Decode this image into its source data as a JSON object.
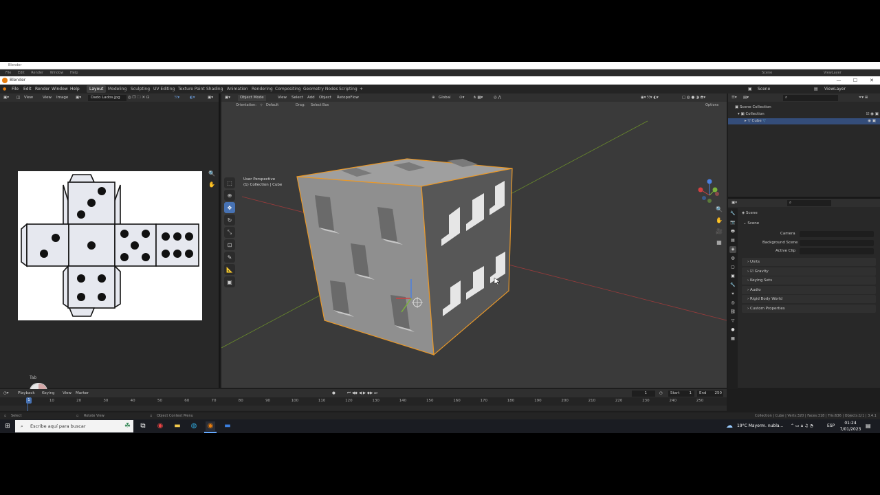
{
  "ghost": {
    "title": "Blender",
    "menu": [
      "File",
      "Edit",
      "Render",
      "Window",
      "Help"
    ],
    "scene": "Scene",
    "viewlayer": "ViewLayer"
  },
  "window": {
    "title": "Blender",
    "minimize": "—",
    "maximize": "☐",
    "close": "✕"
  },
  "menu": {
    "file": "File",
    "edit": "Edit",
    "render": "Render",
    "window": "Window",
    "help": "Help"
  },
  "workspaces": [
    "Layout",
    "Modeling",
    "Sculpting",
    "UV Editing",
    "Texture Paint",
    "Shading",
    "Animation",
    "Rendering",
    "Compositing",
    "Geometry Nodes",
    "Scripting",
    "+"
  ],
  "top_right": {
    "scene": "Scene",
    "view_layer": "ViewLayer"
  },
  "image_editor": {
    "view": "View",
    "view2": "View",
    "image": "Image",
    "filename": "Dado Lados.jpg",
    "tab_hint": "Tab"
  },
  "viewport": {
    "mode": "Object Mode",
    "menus": [
      "View",
      "Select",
      "Add",
      "Object"
    ],
    "addon": "RetopoFlow",
    "transform": "Global",
    "orientation_label": "Orientation:",
    "orientation_value": "Default",
    "drag_label": "Drag:",
    "drag_value": "Select Box",
    "options": "Options",
    "perspective": "User Perspective",
    "collection_info": "(1) Collection | Cube"
  },
  "outliner": {
    "scene_collection": "Scene Collection",
    "collection": "Collection",
    "cube": "Cube"
  },
  "properties": {
    "header": "Scene",
    "panel": "Scene",
    "camera_label": "Camera",
    "bg_scene_label": "Background Scene",
    "active_clip_label": "Active Clip",
    "sections": [
      "Units",
      "Gravity",
      "Keying Sets",
      "Audio",
      "Rigid Body World",
      "Custom Properties"
    ]
  },
  "timeline": {
    "playback": "Playback",
    "keying": "Keying",
    "view": "View",
    "marker": "Marker",
    "current_frame": "1",
    "start_label": "Start",
    "start": "1",
    "end_label": "End",
    "end": "250",
    "ruler": [
      "1",
      "10",
      "20",
      "30",
      "40",
      "50",
      "60",
      "70",
      "80",
      "90",
      "100",
      "110",
      "120",
      "130",
      "140",
      "150",
      "160",
      "170",
      "180",
      "190",
      "200",
      "210",
      "220",
      "230",
      "240",
      "250"
    ]
  },
  "status": {
    "select": "Select",
    "rotate": "Rotate View",
    "context": "Object Context Menu",
    "stats": "Collection | Cube | Verts:320 | Faces:318 | Tris:636 | Objects:1/1 | 3.4.1"
  },
  "taskbar": {
    "search_placeholder": "Escribe aquí para buscar",
    "weather": "19°C  Mayorm. nubla...",
    "lang": "ESP",
    "time": "01:24",
    "date": "7/01/2023"
  }
}
